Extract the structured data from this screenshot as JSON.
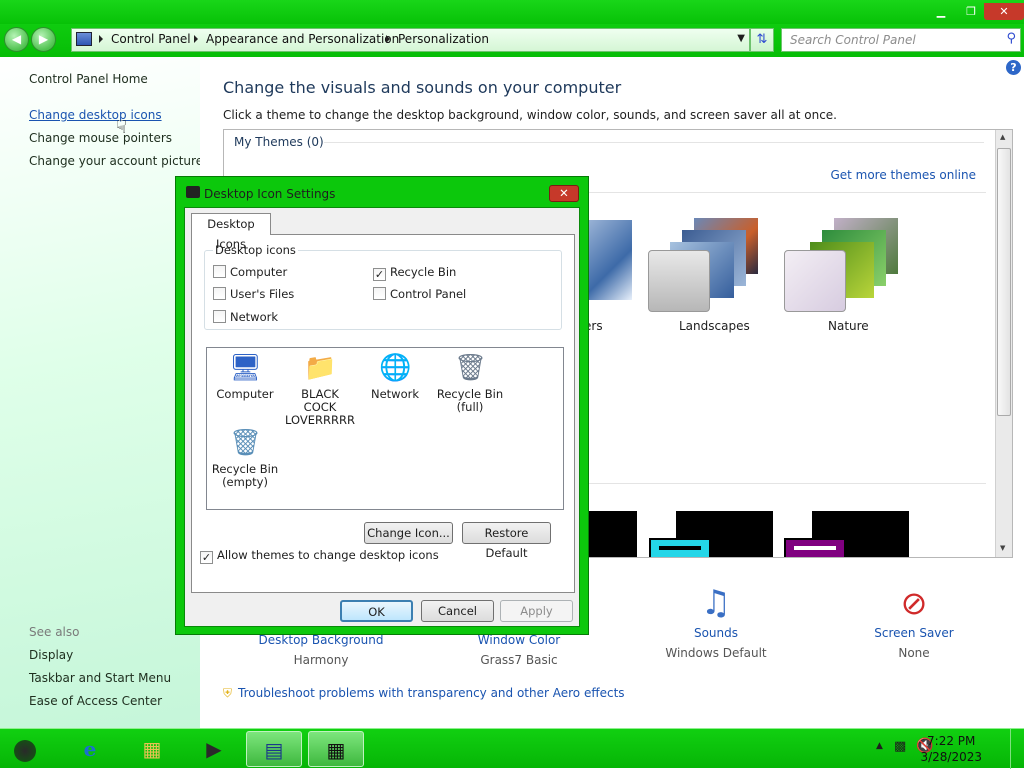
{
  "window": {
    "controls": {
      "minimize": "▁",
      "maximize": "❐",
      "close": "✕"
    }
  },
  "address": {
    "crumbs": [
      "Control Panel",
      "Appearance and Personalization",
      "Personalization"
    ],
    "search_placeholder": "Search Control Panel"
  },
  "sidebar": {
    "home": "Control Panel Home",
    "links": [
      "Change desktop icons",
      "Change mouse pointers",
      "Change your account picture"
    ],
    "see_also": "See also",
    "see_also_items": [
      "Display",
      "Taskbar and Start Menu",
      "Ease of Access Center"
    ]
  },
  "main": {
    "title": "Change the visuals and sounds on your computer",
    "subtitle": "Click a theme to change the desktop background, window color, sounds, and screen saver all at once.",
    "my_themes": "My Themes (0)",
    "get_more": "Get more themes online",
    "themes": [
      "ers",
      "Landscapes",
      "Nature"
    ],
    "bottom": [
      {
        "label": "Desktop Background",
        "value": "Harmony"
      },
      {
        "label": "Window Color",
        "value": "Grass7 Basic"
      },
      {
        "label": "Sounds",
        "value": "Windows Default"
      },
      {
        "label": "Screen Saver",
        "value": "None"
      }
    ],
    "troubleshoot": "Troubleshoot problems with transparency and other Aero effects"
  },
  "dialog": {
    "title": "Desktop Icon Settings",
    "tab": "Desktop Icons",
    "group_label": "Desktop icons",
    "checkboxes": [
      {
        "label": "Computer",
        "checked": false
      },
      {
        "label": "Recycle Bin",
        "checked": true
      },
      {
        "label": "User's Files",
        "checked": false
      },
      {
        "label": "Control Panel",
        "checked": false
      },
      {
        "label": "Network",
        "checked": false
      }
    ],
    "icons": [
      {
        "label": "Computer"
      },
      {
        "label": "BLACK COCK LOVERRRRR"
      },
      {
        "label": "Network"
      },
      {
        "label": "Recycle Bin (full)"
      },
      {
        "label": "Recycle Bin (empty)"
      }
    ],
    "change_icon": "Change Icon...",
    "restore_default": "Restore Default",
    "allow_themes": "Allow themes to change desktop icons",
    "allow_themes_checked": true,
    "ok": "OK",
    "cancel": "Cancel",
    "apply": "Apply"
  },
  "taskbar": {
    "time": "7:22 PM",
    "date": "3/28/2023"
  },
  "colors": {
    "accent": "#0cc80c",
    "link": "#1a54b0"
  }
}
